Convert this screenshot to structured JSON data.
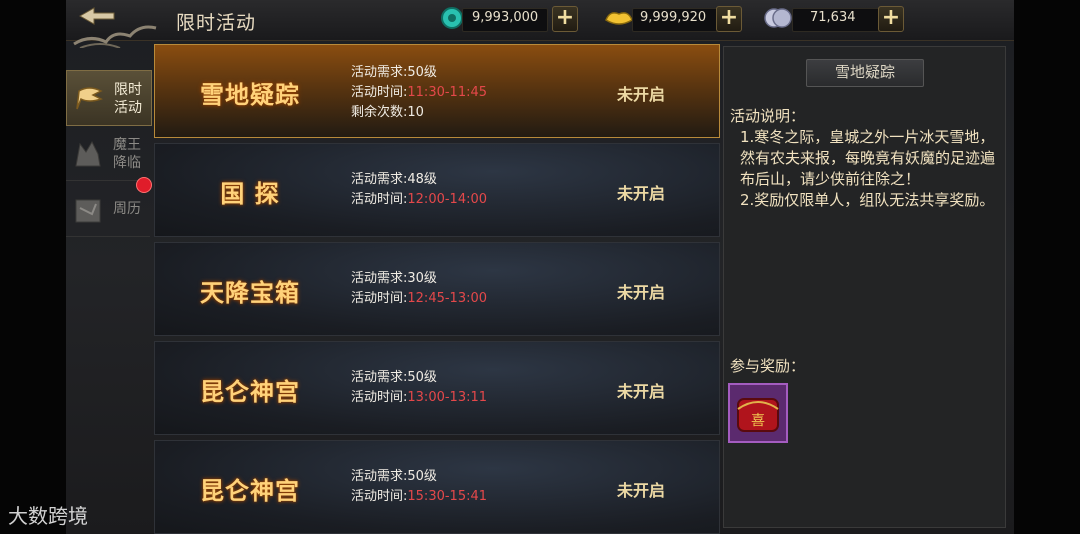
{
  "header": {
    "title": "限时活动",
    "currencies": [
      {
        "icon": "jade-icon",
        "value": "9,993,000"
      },
      {
        "icon": "gold-ingot-icon",
        "value": "9,999,920"
      },
      {
        "icon": "silver-coin-icon",
        "value": "71,634"
      }
    ]
  },
  "sidebar": {
    "items": [
      {
        "label": "限时活动",
        "active": true
      },
      {
        "label": "魔王降临",
        "active": false
      },
      {
        "label": "周历",
        "active": false
      }
    ]
  },
  "activities": [
    {
      "name": "雪地疑踪",
      "req": "活动需求:50级",
      "time_label": "活动时间:",
      "time": "11:30-11:45",
      "extra": "剩余次数:10",
      "status": "未开启"
    },
    {
      "name": "国 探",
      "req": "活动需求:48级",
      "time_label": "活动时间:",
      "time": "12:00-14:00",
      "status": "未开启"
    },
    {
      "name": "天降宝箱",
      "req": "活动需求:30级",
      "time_label": "活动时间:",
      "time": "12:45-13:00",
      "status": "未开启"
    },
    {
      "name": "昆仑神宫",
      "req": "活动需求:50级",
      "time_label": "活动时间:",
      "time": "13:00-13:11",
      "status": "未开启"
    },
    {
      "name": "昆仑神宫",
      "req": "活动需求:50级",
      "time_label": "活动时间:",
      "time": "15:30-15:41",
      "status": "未开启"
    }
  ],
  "detail": {
    "title": "雪地疑踪",
    "desc_heading": "活动说明：",
    "desc_lines": [
      "1.寒冬之际，皇城之外一片冰天雪地，然有农夫来报，每晚竟有妖魔的足迹遍布后山，请少侠前往除之！",
      "2.奖励仅限单人，组队无法共享奖励。"
    ],
    "reward_heading": "参与奖励：",
    "reward_item_char": "喜"
  },
  "watermark": "大数跨境",
  "colors": {
    "accent": "#ffd27a",
    "time_red": "#e4484a",
    "badge_red": "#e01d2a"
  }
}
